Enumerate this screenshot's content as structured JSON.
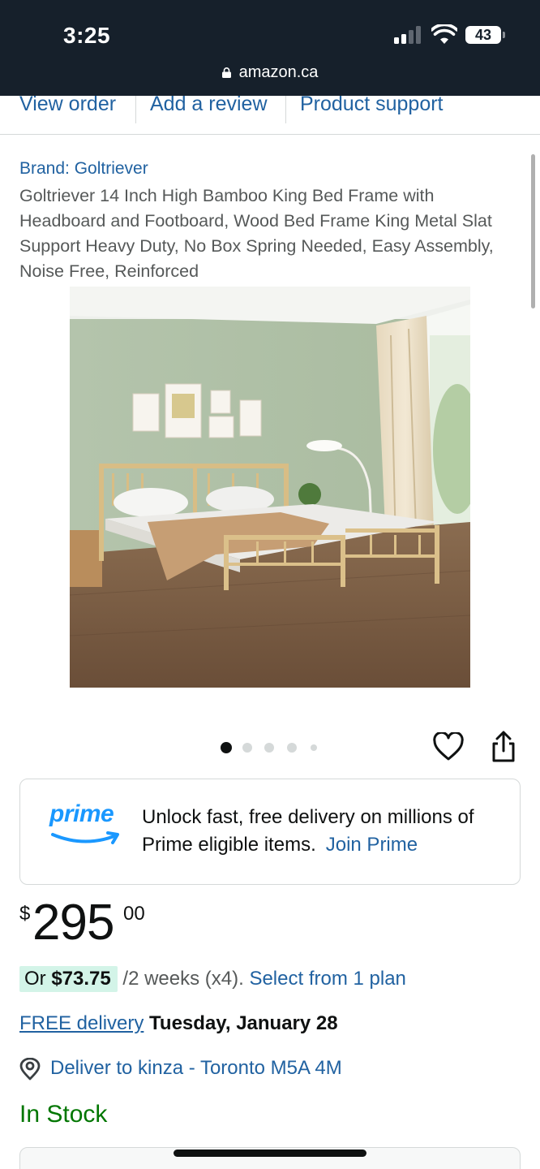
{
  "status_bar": {
    "time": "3:25",
    "battery": "43",
    "url": "amazon.ca",
    "icons": [
      "cellular-signal-icon",
      "wifi-icon",
      "battery-icon",
      "lock-icon"
    ]
  },
  "top_links": [
    "View order",
    "Add a review",
    "Product support"
  ],
  "product": {
    "brand": "Brand: Goltriever",
    "title": "Goltriever 14 Inch High Bamboo King Bed Frame with Headboard and Footboard, Wood Bed Frame King Metal Slat Support Heavy Duty, No Box Spring Needed, Easy Assembly, Noise Free, Reinforced",
    "image_alt": "Bamboo king bed frame in a green bedroom"
  },
  "carousel": {
    "count": 5,
    "active": 1
  },
  "prime": {
    "logo": "prime",
    "message": "Unlock fast, free delivery on millions of Prime eligible items.",
    "link": "Join Prime"
  },
  "price": {
    "currency": "$",
    "whole": "295",
    "fraction": "00"
  },
  "installment": {
    "prefix": "Or ",
    "amount": "$73.75",
    "period": " /2 weeks (x4).",
    "link": "Select from 1 plan"
  },
  "delivery": {
    "label": "FREE delivery",
    "date": "Tuesday, January 28"
  },
  "deliver_to": "Deliver to kinza - Toronto M5A 4M",
  "stock": "In Stock",
  "colors": {
    "link": "#2162a1",
    "prime_blue": "#1a98ff",
    "in_stock": "#007600",
    "installment_bg": "#d3f4e8",
    "status_bar_bg": "#16202b"
  }
}
